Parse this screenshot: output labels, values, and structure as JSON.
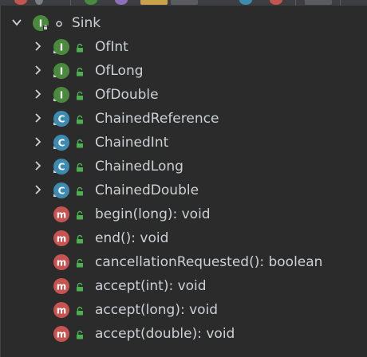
{
  "toolbar": {
    "icons": [
      {
        "name": "toolbar-icon-1",
        "color": "#c75450"
      },
      {
        "name": "toolbar-icon-2",
        "color": "#7a7e85"
      },
      {
        "name": "toolbar-icon-3",
        "color": "#4a8a3c"
      },
      {
        "name": "toolbar-icon-4",
        "color": "#8e6fbd"
      },
      {
        "name": "toolbar-icon-5",
        "color": "#c9a24a"
      },
      {
        "name": "toolbar-icon-6",
        "color": "#5a5d60"
      },
      {
        "name": "toolbar-icon-7",
        "color": "#3d8bb0"
      },
      {
        "name": "toolbar-icon-8",
        "color": "#c75450"
      },
      {
        "name": "toolbar-icon-9",
        "color": "#5a5d60"
      }
    ]
  },
  "colors": {
    "interface": "#4a8a3c",
    "class": "#3d8bb0",
    "method": "#c75450",
    "lock": "#4caf50",
    "text": "#cdd1d6",
    "background": "#2b2b2b"
  },
  "tree": {
    "root": {
      "label": "Sink",
      "icon": "interface-icon",
      "badge": "static-dot-icon",
      "expanded": true
    },
    "nodes": [
      {
        "label": "OfInt",
        "kind": "interface",
        "icon": "interface-icon"
      },
      {
        "label": "OfLong",
        "kind": "interface",
        "icon": "interface-icon"
      },
      {
        "label": "OfDouble",
        "kind": "interface",
        "icon": "interface-icon"
      },
      {
        "label": "ChainedReference",
        "kind": "class",
        "icon": "class-icon"
      },
      {
        "label": "ChainedInt",
        "kind": "class",
        "icon": "class-icon"
      },
      {
        "label": "ChainedLong",
        "kind": "class",
        "icon": "class-icon"
      },
      {
        "label": "ChainedDouble",
        "kind": "class",
        "icon": "class-icon"
      },
      {
        "label": "begin(long): void",
        "kind": "method",
        "icon": "method-icon"
      },
      {
        "label": "end(): void",
        "kind": "method",
        "icon": "method-icon"
      },
      {
        "label": "cancellationRequested(): boolean",
        "kind": "method",
        "icon": "method-icon"
      },
      {
        "label": "accept(int): void",
        "kind": "method",
        "icon": "method-icon"
      },
      {
        "label": "accept(long): void",
        "kind": "method",
        "icon": "method-icon"
      },
      {
        "label": "accept(double): void",
        "kind": "method",
        "icon": "method-icon"
      }
    ]
  }
}
